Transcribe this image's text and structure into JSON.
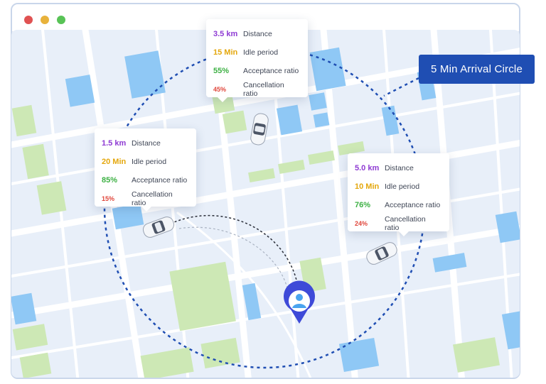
{
  "colors": {
    "distance": "#8e3ad3",
    "idle": "#e4a70c",
    "acceptance": "#3cb043",
    "cancellation": "#e0463b",
    "accent": "#1f4eb3"
  },
  "arrival_label": "5 Min Arrival Circle",
  "icons": {
    "user_pin": "user-location-pin-icon",
    "car": "car-icon"
  },
  "cards": [
    {
      "id": "top",
      "rows": [
        {
          "value": "3.5 km",
          "label": "Distance"
        },
        {
          "value": "15 Min",
          "label": "Idle period"
        },
        {
          "value": "55%",
          "label": "Acceptance ratio"
        },
        {
          "value": "45%",
          "label": "Cancellation ratio"
        }
      ]
    },
    {
      "id": "left",
      "rows": [
        {
          "value": "1.5 km",
          "label": "Distance"
        },
        {
          "value": "20 Min",
          "label": "Idle period"
        },
        {
          "value": "85%",
          "label": "Acceptance ratio"
        },
        {
          "value": "15%",
          "label": "Cancellation ratio"
        }
      ]
    },
    {
      "id": "right",
      "rows": [
        {
          "value": "5.0 km",
          "label": "Distance"
        },
        {
          "value": "10 Min",
          "label": "Idle period"
        },
        {
          "value": "76%",
          "label": "Acceptance ratio"
        },
        {
          "value": "24%",
          "label": "Cancellation ratio"
        }
      ]
    }
  ]
}
